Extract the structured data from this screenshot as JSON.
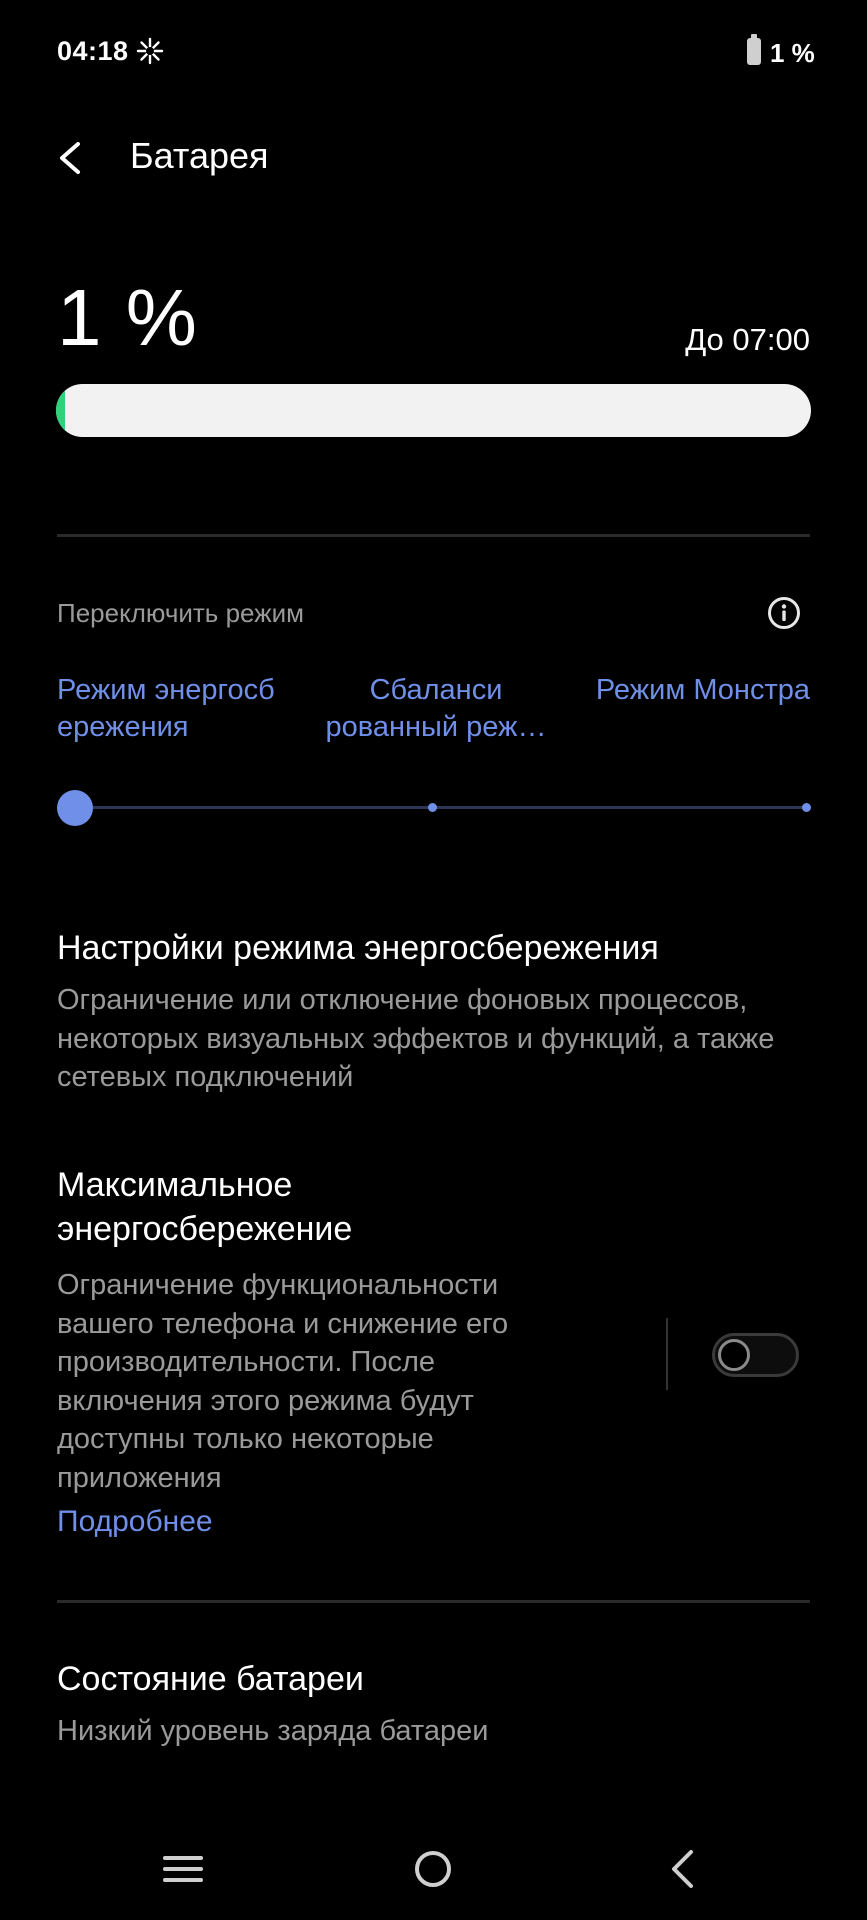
{
  "status_bar": {
    "time": "04:18",
    "battery_text": "1 %"
  },
  "header": {
    "title": "Батарея"
  },
  "battery": {
    "percent_text": "1 %",
    "until_text": "До 07:00",
    "level_fraction": 0.01,
    "fill_color": "#2fd17a"
  },
  "mode_switch": {
    "label": "Переключить режим",
    "modes": [
      "Режим энергосб ережения",
      "Сбаланси рованный реж…",
      "Режим Монстра"
    ],
    "selected_index": 0,
    "accent_color": "#6f8fe8"
  },
  "settings": {
    "power_saving": {
      "title": "Настройки режима энергосбережения",
      "description": "Ограничение или отключение фоновых процессов, некоторых визуальных эффектов и функций, а также сетевых подключений"
    },
    "max_saving": {
      "title": "Максимальное энергосбережение",
      "description": "Ограничение функциональности вашего телефона и снижение его производительности. После включения этого режима будут доступны только некоторые приложения",
      "link": "Подробнее",
      "enabled": false
    },
    "battery_state": {
      "title": "Состояние батареи",
      "description": "Низкий уровень заряда батареи"
    }
  },
  "icons": {
    "back": "chevron-left-icon",
    "info": "info-icon",
    "status": "sparkle-icon",
    "nav_menu": "menu-icon",
    "nav_home": "home-icon",
    "nav_back": "back-icon"
  }
}
